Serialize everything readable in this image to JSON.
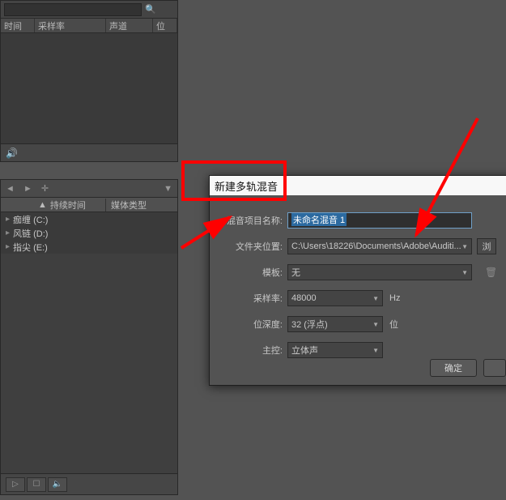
{
  "top_panel": {
    "search_value": "",
    "headers": {
      "time": "时间",
      "rate": "采样率",
      "chan": "声道",
      "pos": "位"
    },
    "speaker_glyph": "🔊"
  },
  "bot_panel": {
    "toolbar": {
      "back": "◄",
      "fwd": "►",
      "add": "✛",
      "filter": "▼"
    },
    "headers": {
      "sort_glyph": "▲",
      "duration": "持续时间",
      "type": "媒体类型"
    },
    "rows": [
      {
        "label": "痂缠 (C:)"
      },
      {
        "label": "风链 (D:)"
      },
      {
        "label": "指尖 (E:)"
      }
    ],
    "footer": {
      "play": "▷",
      "open": "☐",
      "mute": "🔈"
    }
  },
  "dialog": {
    "title": "新建多轨混音",
    "labels": {
      "name": "混音项目名称:",
      "folder": "文件夹位置:",
      "template": "模板:",
      "rate": "采样率:",
      "depth": "位深度:",
      "master": "主控:"
    },
    "values": {
      "name": "未命名混音 1",
      "folder": "C:\\Users\\18226\\Documents\\Adobe\\Auditi...",
      "template": "无",
      "rate": "48000",
      "depth": "32 (浮点)",
      "master": "立体声"
    },
    "units": {
      "rate": "Hz",
      "depth": "位"
    },
    "browse_label": "浏",
    "ok": "确定"
  }
}
